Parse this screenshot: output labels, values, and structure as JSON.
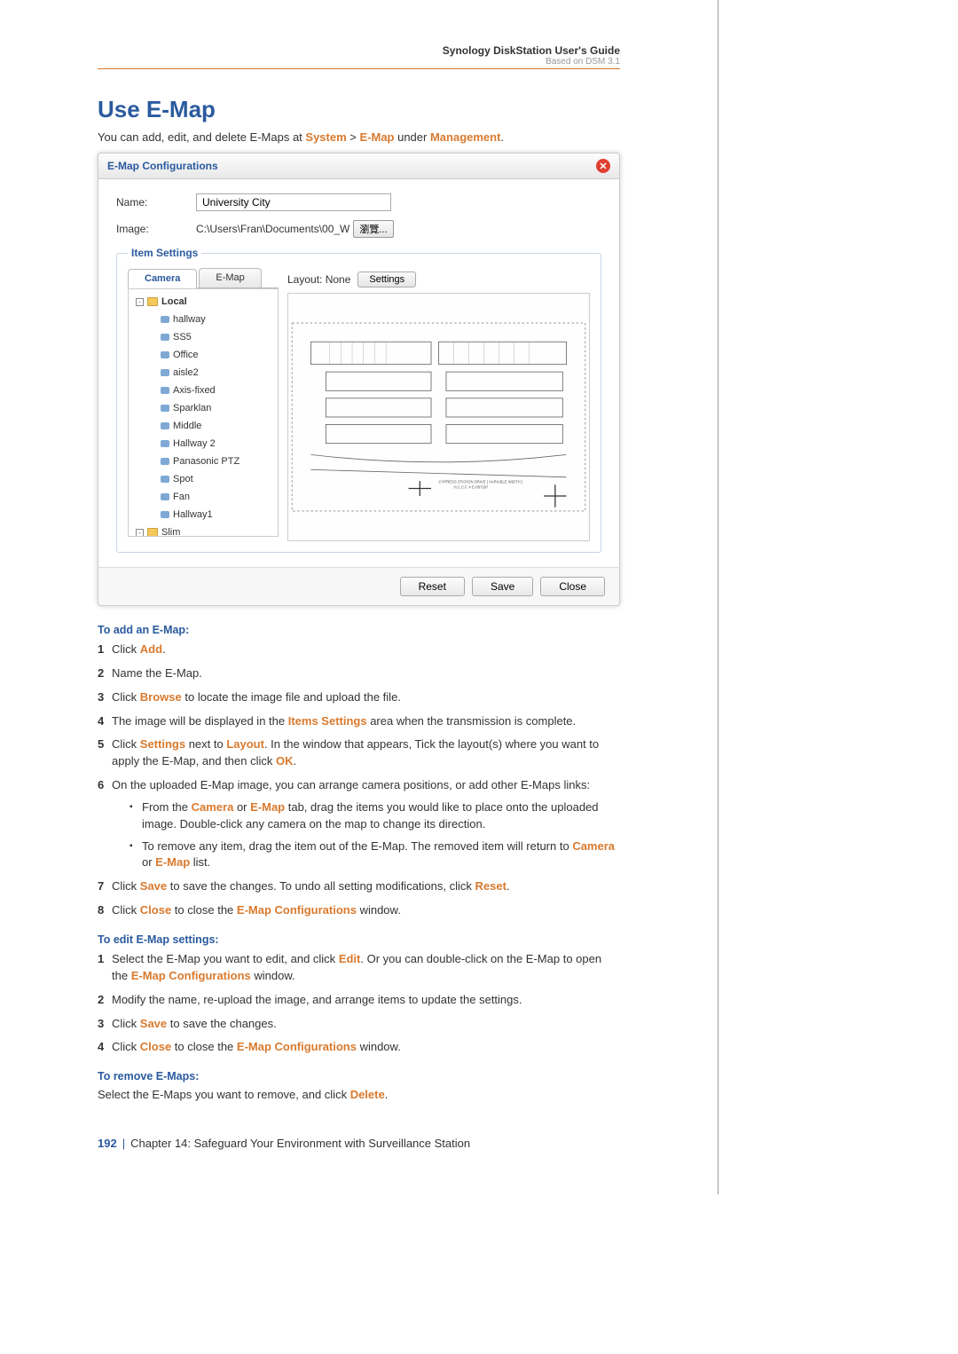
{
  "header": {
    "title": "Synology DiskStation User's Guide",
    "subtitle": "Based on DSM 3.1"
  },
  "section_title": "Use E-Map",
  "intro": {
    "pre": "You can add, edit, and delete E-Maps at ",
    "nav1": "System",
    "sep": " > ",
    "nav2": "E-Map",
    "post": " under ",
    "nav3": "Management",
    "end": "."
  },
  "dialog": {
    "title": "E-Map Configurations",
    "name_label": "Name:",
    "name_value": "University City",
    "image_label": "Image:",
    "image_path": "C:\\Users\\Fran\\Documents\\00_W",
    "browse_label": "瀏覽...",
    "fieldset_legend": "Item Settings",
    "tabs": {
      "camera": "Camera",
      "emap": "E-Map"
    },
    "layout_label": "Layout: None",
    "settings_btn": "Settings",
    "tree": {
      "local": "Local",
      "items": [
        "hallway",
        "SS5",
        "Office",
        "aisle2",
        "Axis-fixed",
        "Sparklan",
        "Middle",
        "Hallway 2",
        "Panasonic PTZ",
        "Spot",
        "Fan",
        "Hallway1"
      ],
      "slim": "Slim"
    },
    "buttons": {
      "reset": "Reset",
      "save": "Save",
      "close": "Close"
    }
  },
  "add_heading": "To add an E-Map:",
  "add_steps": {
    "s1a": "Click ",
    "s1b": "Add",
    "s1c": ".",
    "s2": "Name the E-Map.",
    "s3a": "Click ",
    "s3b": "Browse",
    "s3c": " to locate the image file and upload the file.",
    "s4a": "The image will be displayed in the ",
    "s4b": "Items Settings",
    "s4c": " area when the transmission is complete.",
    "s5a": "Click ",
    "s5b": "Settings",
    "s5c": " next to ",
    "s5d": "Layout",
    "s5e": ". In the window that appears, Tick the layout(s) where you want to apply the E-Map, and then click ",
    "s5f": "OK",
    "s5g": ".",
    "s6": "On the uploaded E-Map image, you can arrange camera positions, or add other E-Maps links:",
    "s6b1a": "From the ",
    "s6b1b": "Camera",
    "s6b1c": " or ",
    "s6b1d": "E-Map",
    "s6b1e": " tab, drag the items you would like to place onto the uploaded image. Double-click any camera on the map to change its direction.",
    "s6b2a": "To remove any item, drag the item out of the E-Map. The removed item will return to ",
    "s6b2b": "Camera",
    "s6b2c": " or ",
    "s6b2d": "E-Map",
    "s6b2e": " list.",
    "s7a": "Click ",
    "s7b": "Save",
    "s7c": " to save the changes. To undo all setting modifications, click ",
    "s7d": "Reset",
    "s7e": ".",
    "s8a": "Click ",
    "s8b": "Close",
    "s8c": " to close the ",
    "s8d": "E-Map Configurations",
    "s8e": " window."
  },
  "edit_heading": "To edit E-Map settings:",
  "edit_steps": {
    "s1a": "Select the E-Map you want to edit, and click ",
    "s1b": "Edit",
    "s1c": ". Or you can double-click on the E-Map to open the ",
    "s1d": "E-Map Configurations",
    "s1e": " window.",
    "s2": "Modify the name, re-upload the image, and arrange items to update the settings.",
    "s3a": "Click ",
    "s3b": "Save",
    "s3c": " to save the changes.",
    "s4a": "Click ",
    "s4b": "Close",
    "s4c": " to close the ",
    "s4d": "E-Map Configurations",
    "s4e": " window."
  },
  "remove_heading": "To remove E-Maps:",
  "remove_text": {
    "a": "Select the E-Maps you want to remove, and click ",
    "b": "Delete",
    "c": "."
  },
  "footer": {
    "page": "192",
    "chapter": "Chapter 14: Safeguard Your Environment with Surveillance Station"
  }
}
